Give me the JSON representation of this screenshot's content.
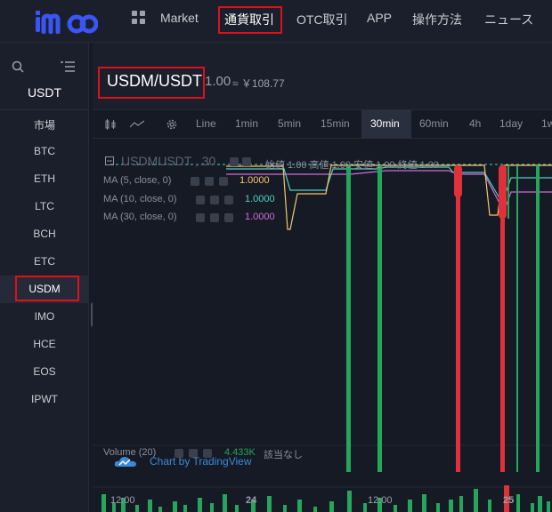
{
  "nav": {
    "items": [
      "Market",
      "通貨取引",
      "OTC取引",
      "APP",
      "操作方法",
      "ニュース"
    ]
  },
  "sidebar": {
    "quote": "USDT",
    "market_label": "市場",
    "items": [
      "BTC",
      "ETH",
      "LTC",
      "BCH",
      "ETC",
      "USDM",
      "IMO",
      "HCE",
      "EOS",
      "IPWT"
    ],
    "active": "USDM"
  },
  "pair": {
    "name": "USDM/USDT",
    "price": "1.00",
    "approx": "≈ ￥108.77"
  },
  "toolbar": {
    "intervals": [
      "Line",
      "1min",
      "5min",
      "15min",
      "30min",
      "60min",
      "4h",
      "1day",
      "1w"
    ],
    "active": "30min"
  },
  "chart": {
    "symbol": "USDMUSDT , 30",
    "ohlc": "始値 1.00  高値 1.00  安値 1.00  終値 1.00",
    "ma5_label": "MA (5, close, 0)",
    "ma10_label": "MA (10, close, 0)",
    "ma30_label": "MA (30, close, 0)",
    "ma5_value": "1.0000",
    "ma10_value": "1.0000",
    "ma30_value": "1.0000",
    "volume_label": "Volume (20)",
    "volume_value": "4.433K",
    "volume_note": "該当なし",
    "watermark": "Chart by TradingView",
    "x_labels": [
      "12:00",
      "24",
      "12:00",
      "25"
    ]
  },
  "colors": {
    "up": "#26a65b",
    "down": "#e0303a",
    "ma5": "#f5c76a",
    "ma10": "#4fd1c5",
    "ma30": "#d36ad8",
    "accent": "#e0101a"
  }
}
